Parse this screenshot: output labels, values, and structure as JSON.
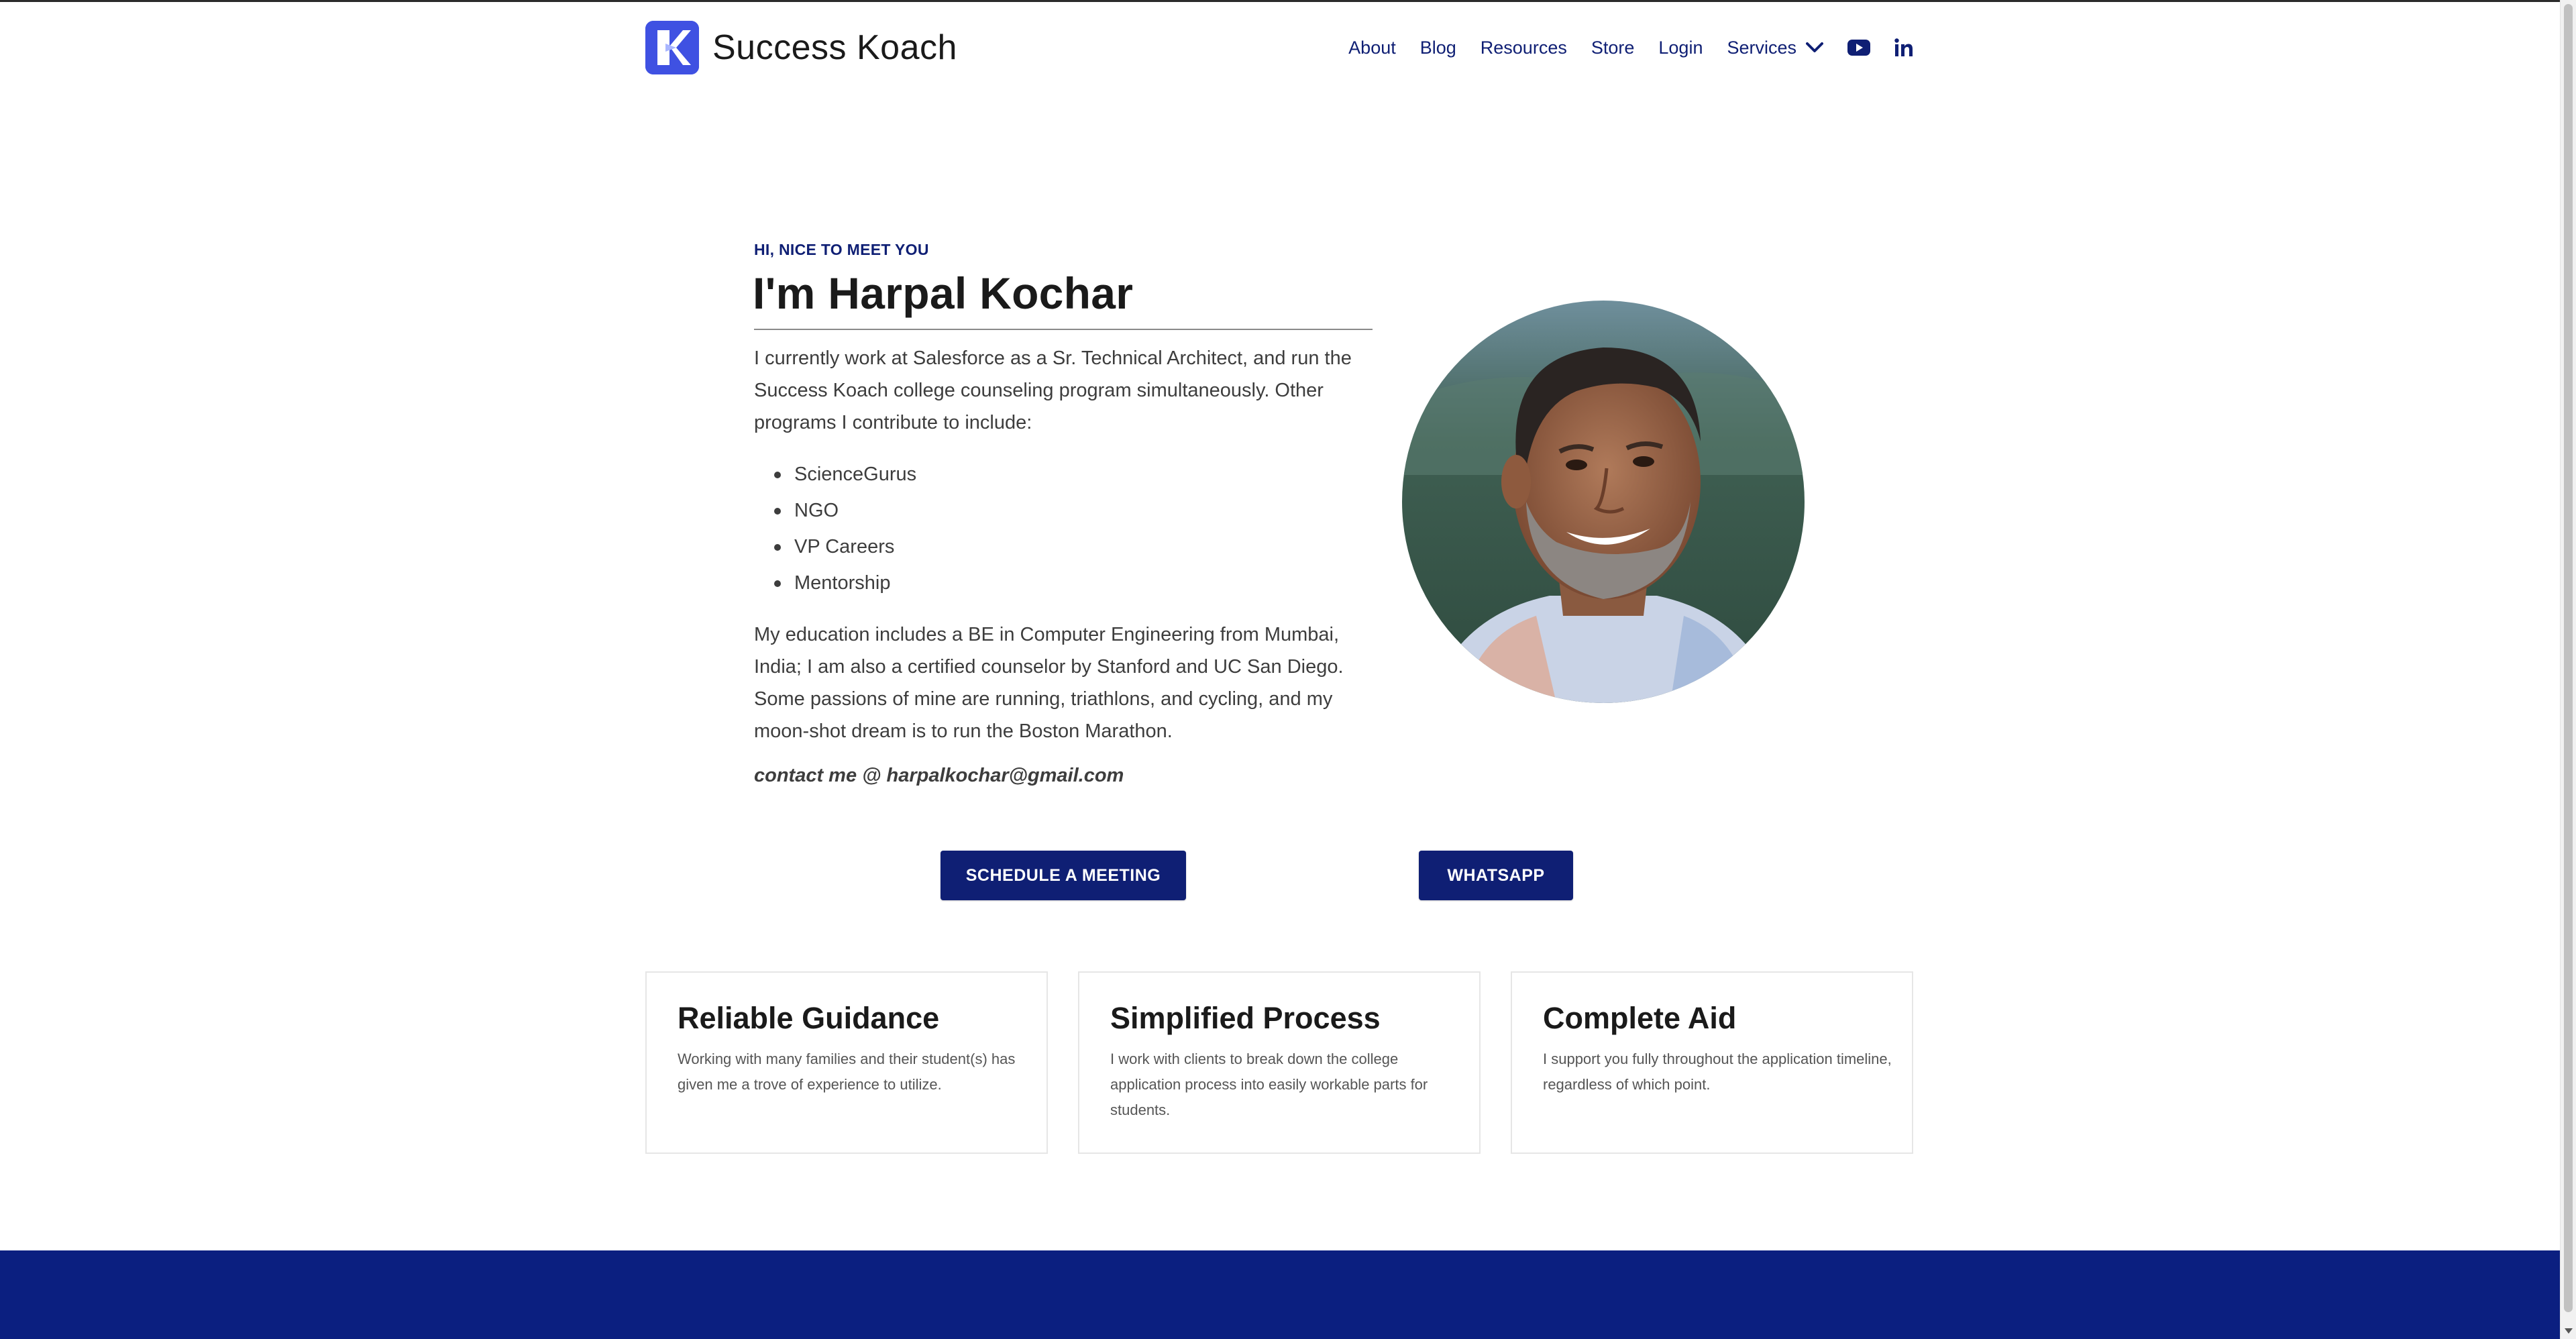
{
  "brand": {
    "name": "Success Koach",
    "accent": "#3f51e2",
    "primary": "#0f1f74"
  },
  "nav": {
    "items": [
      "About",
      "Blog",
      "Resources",
      "Store",
      "Login",
      "Services"
    ],
    "social": [
      "youtube-icon",
      "linkedin-icon"
    ]
  },
  "intro": {
    "kicker": "HI, NICE TO MEET YOU",
    "title": "I'm Harpal Kochar",
    "paragraph1": "I currently work at Salesforce as a Sr. Technical Architect, and run the Success Koach college counseling program simultaneously. Other programs I contribute to include:",
    "programs": [
      "ScienceGurus",
      "NGO",
      "VP Careers",
      "Mentorship"
    ],
    "paragraph2": "My education includes a BE in Computer Engineering from Mumbai, India; I am also a certified counselor by Stanford and UC San Diego. Some passions of mine are running, triathlons, and cycling, and my moon-shot dream is to run the Boston Marathon.",
    "contact": "contact me @ harpalkochar@gmail.com"
  },
  "buttons": {
    "schedule": "SCHEDULE A MEETING",
    "whatsapp": "WHATSAPP"
  },
  "cards": [
    {
      "title": "Reliable Guidance",
      "text": "Working with many families and their student(s) has given me a trove of experience to utilize."
    },
    {
      "title": "Simplified Process",
      "text": "I work with clients to break down the college application process into easily workable parts for students."
    },
    {
      "title": "Complete Aid",
      "text": "I support you fully throughout the application timeline, regardless of which point."
    }
  ],
  "footer": {
    "color": "#0b1f80"
  }
}
